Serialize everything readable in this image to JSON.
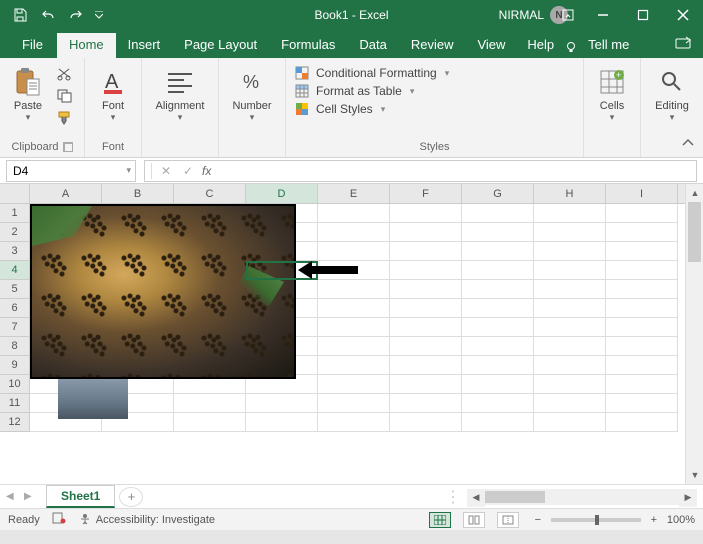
{
  "titlebar": {
    "title": "Book1  -  Excel",
    "user_name": "NIRMAL",
    "avatar_initial": "N"
  },
  "tabs": {
    "file": "File",
    "home": "Home",
    "insert": "Insert",
    "page_layout": "Page Layout",
    "formulas": "Formulas",
    "data": "Data",
    "review": "Review",
    "view": "View",
    "help": "Help",
    "tell_me": "Tell me"
  },
  "ribbon": {
    "clipboard": {
      "label": "Clipboard",
      "paste": "Paste"
    },
    "font": {
      "label": "Font",
      "btn": "Font"
    },
    "alignment": {
      "label": "",
      "btn": "Alignment"
    },
    "number": {
      "label": "",
      "btn": "Number"
    },
    "styles": {
      "label": "Styles",
      "cond_format": "Conditional Formatting",
      "format_table": "Format as Table",
      "cell_styles": "Cell Styles"
    },
    "cells": {
      "label": "",
      "btn": "Cells"
    },
    "editing": {
      "label": "",
      "btn": "Editing"
    }
  },
  "namebox": {
    "value": "D4"
  },
  "formula_bar": {
    "value": ""
  },
  "columns": [
    "A",
    "B",
    "C",
    "D",
    "E",
    "F",
    "G",
    "H",
    "I"
  ],
  "rows_visible": [
    1,
    2,
    3,
    4,
    5,
    6,
    7,
    8,
    9,
    10,
    11,
    12
  ],
  "active_cell": {
    "col": "D",
    "row": 4
  },
  "sheets": {
    "active": "Sheet1"
  },
  "statusbar": {
    "ready": "Ready",
    "accessibility": "Accessibility: Investigate",
    "zoom": "100%"
  }
}
